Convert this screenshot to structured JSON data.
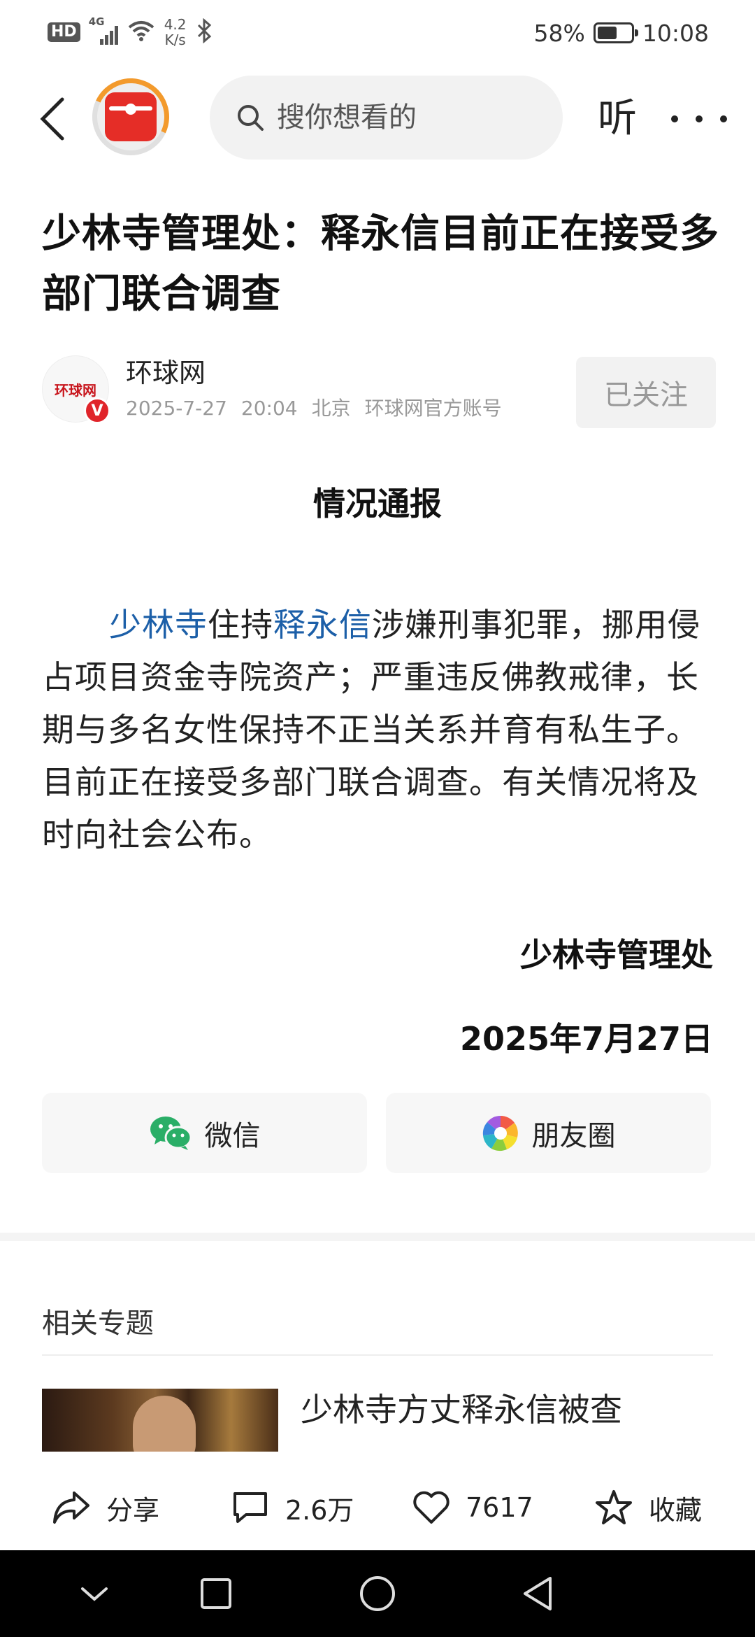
{
  "status_bar": {
    "hd": "HD",
    "signal": "4G",
    "speed_value": "4.2",
    "speed_unit": "K/s",
    "battery_text": "58%",
    "battery_level": 0.58,
    "time": "10:08"
  },
  "nav": {
    "search_placeholder": "搜你想看的",
    "listen_label": "听"
  },
  "article": {
    "title": "少林寺管理处：释永信目前正在接受多部门联合调查",
    "author_name": "环球网",
    "author_avatar_text": "环球网",
    "verified_label": "V",
    "date": "2025-7-27",
    "time": "20:04",
    "location": "北京",
    "account_type": "环球网官方账号",
    "follow_label": "已关注",
    "heading": "情况通报",
    "body_link_1": "少林寺",
    "body_text_1": "住持",
    "body_link_2": "释永信",
    "body_text_2": "涉嫌刑事犯罪，挪用侵占项目资金寺院资产；严重违反佛教戒律，长期与多名女性保持不正当关系并育有私生子。目前正在接受多部门联合调查。有关情况将及时向社会公布。",
    "signature_org": "少林寺管理处",
    "signature_date": "2025年7月27日"
  },
  "share": {
    "wechat_label": "微信",
    "moments_label": "朋友圈"
  },
  "related": {
    "section_label": "相关专题",
    "item_title": "少林寺方丈释永信被查"
  },
  "actions": {
    "share_label": "分享",
    "comment_count": "2.6万",
    "like_count": "7617",
    "collect_label": "收藏"
  }
}
